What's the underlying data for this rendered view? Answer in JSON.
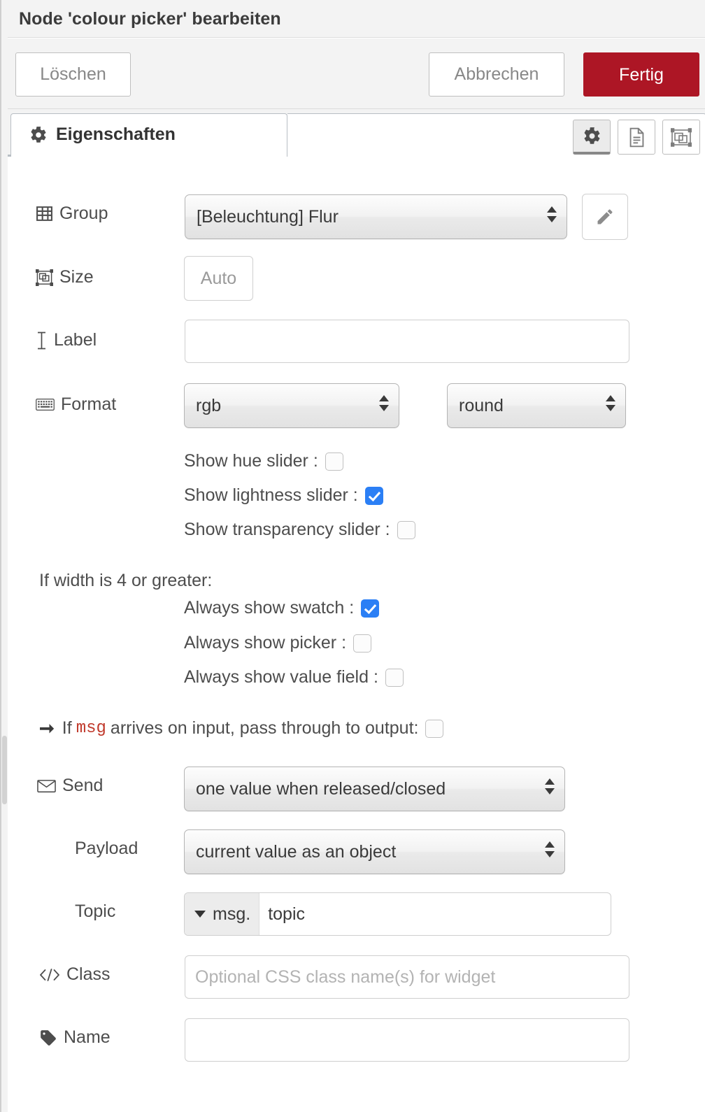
{
  "window": {
    "title": "Node 'colour picker' bearbeiten"
  },
  "buttons": {
    "delete": "Löschen",
    "cancel": "Abbrechen",
    "done": "Fertig"
  },
  "tabs": {
    "properties": "Eigenschaften",
    "icon_buttons": [
      {
        "name": "properties-gear-icon",
        "selected": true
      },
      {
        "name": "description-document-icon",
        "selected": false
      },
      {
        "name": "appearance-object-group-icon",
        "selected": false
      }
    ]
  },
  "form": {
    "group": {
      "label": "Group",
      "value": "[Beleuchtung] Flur",
      "edit_button_icon": "pencil-icon"
    },
    "size": {
      "label": "Size",
      "value": "Auto"
    },
    "label_field": {
      "label": "Label",
      "value": "",
      "placeholder": ""
    },
    "format": {
      "label": "Format",
      "value": "rgb",
      "rounding_value": "round"
    },
    "slider_options": [
      {
        "label": "Show hue slider :",
        "checked": false
      },
      {
        "label": "Show lightness slider :",
        "checked": true
      },
      {
        "label": "Show transparency slider :",
        "checked": false
      }
    ],
    "width_section": {
      "heading": "If width is 4 or greater:",
      "options": [
        {
          "label": "Always show swatch :",
          "checked": true
        },
        {
          "label": "Always show picker :",
          "checked": false
        },
        {
          "label": "Always show value field :",
          "checked": false
        }
      ]
    },
    "passthrough": {
      "prefix": "If",
      "keyword": "msg",
      "suffix": "arrives on input, pass through to output:",
      "checked": false
    },
    "send": {
      "label": "Send",
      "value": "one value when released/closed"
    },
    "payload": {
      "label": "Payload",
      "value": "current value as an object"
    },
    "topic": {
      "label": "Topic",
      "type": "msg.",
      "value": "topic",
      "placeholder": ""
    },
    "css_class": {
      "label": "Class",
      "value": "",
      "placeholder": "Optional CSS class name(s) for widget"
    },
    "name": {
      "label": "Name",
      "value": "",
      "placeholder": ""
    }
  },
  "colors": {
    "brand_red": "#ad1625",
    "checkbox_blue": "#2b7ff5",
    "keyword_red": "#c0392b",
    "chrome_grey": "#f3f3f3"
  }
}
